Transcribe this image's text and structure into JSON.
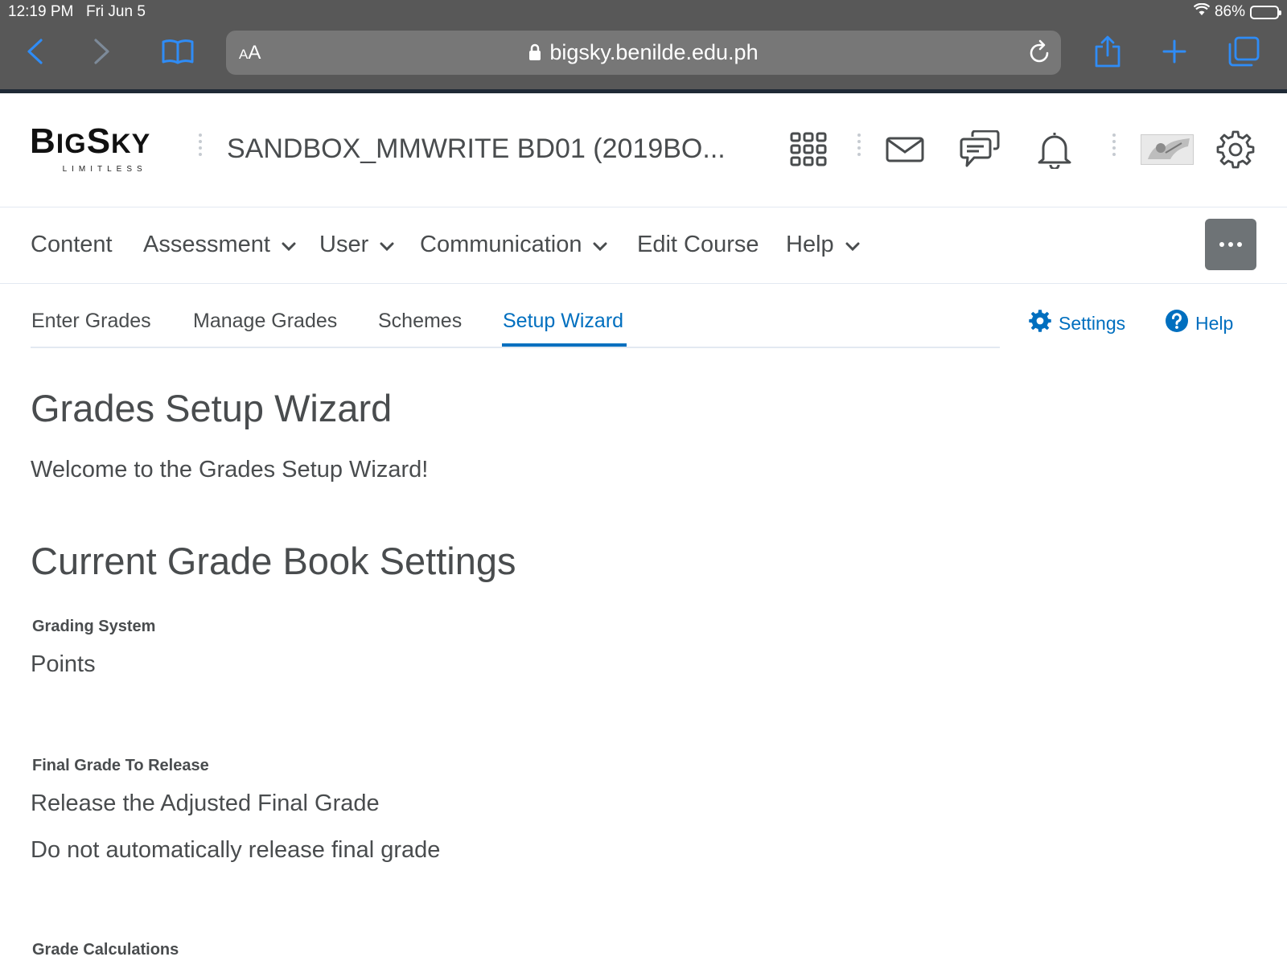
{
  "status_bar": {
    "time": "12:19 PM",
    "date": "Fri Jun 5",
    "battery": "86%",
    "battery_level": 0.86
  },
  "browser": {
    "aa_label_small": "A",
    "aa_label_large": "A",
    "url": "bigsky.benilde.edu.ph"
  },
  "header": {
    "logo_word_parts": [
      "B",
      "IG",
      "S",
      "KY"
    ],
    "logo_tagline": "LIMITLESS",
    "course_title": "SANDBOX_MMWRITE BD01 (2019BO..."
  },
  "navbar": {
    "items": [
      {
        "label": "Content",
        "has_menu": false
      },
      {
        "label": "Assessment",
        "has_menu": true
      },
      {
        "label": "User",
        "has_menu": true
      },
      {
        "label": "Communication",
        "has_menu": true
      },
      {
        "label": "Edit Course",
        "has_menu": false
      },
      {
        "label": "Help",
        "has_menu": true
      }
    ]
  },
  "tabs": {
    "items": [
      {
        "label": "Enter Grades",
        "active": false
      },
      {
        "label": "Manage Grades",
        "active": false
      },
      {
        "label": "Schemes",
        "active": false
      },
      {
        "label": "Setup Wizard",
        "active": true
      }
    ],
    "settings_label": "Settings",
    "help_label": "Help"
  },
  "page": {
    "title": "Grades Setup Wizard",
    "welcome": "Welcome to the Grades Setup Wizard!",
    "section_title": "Current Grade Book Settings",
    "grading_system_label": "Grading System",
    "grading_system_value": "Points",
    "final_grade_label": "Final Grade To Release",
    "final_grade_value": "Release the Adjusted Final Grade",
    "release_value": "Do not automatically release final grade",
    "grade_calc_label": "Grade Calculations"
  },
  "colors": {
    "accent": "#006fbf",
    "text": "#494c4e",
    "browser_chrome": "#585858",
    "ios_blue": "#2f8cf6"
  }
}
